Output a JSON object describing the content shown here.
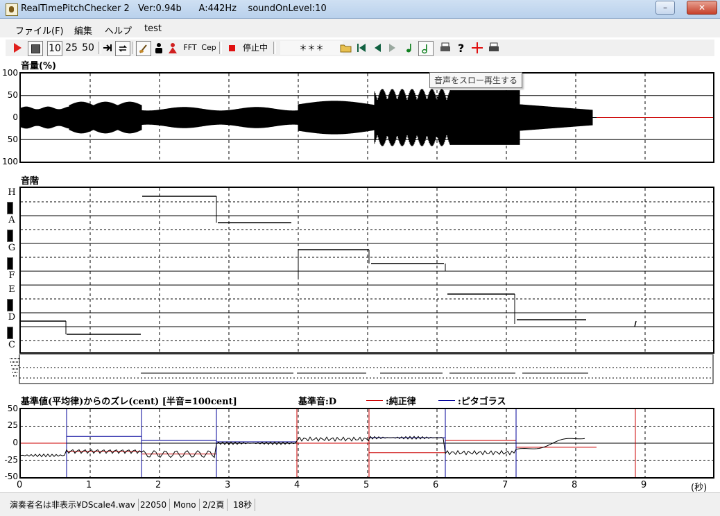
{
  "window": {
    "title": "RealTimePitchChecker 2",
    "version": "Ver:0.94b",
    "a_pitch": "A:442Hz",
    "sound_on_level": "soundOnLevel:10",
    "minimize": "–",
    "maximize": "□",
    "close": "✕"
  },
  "menu": {
    "file": "ファイル(F)",
    "edit": "編集",
    "help": "ヘルプ",
    "test": "test"
  },
  "toolbar": {
    "speed_10": "10",
    "speed_25": "25",
    "speed_50": "50",
    "fft": "FFT",
    "cep": "Cep",
    "status": "停止中",
    "marker": "＊＊＊"
  },
  "tooltip": "音声をスロー再生する",
  "volume": {
    "title": "音量(%)",
    "ticks": [
      "100",
      "50",
      "0",
      "50",
      "100"
    ]
  },
  "scale": {
    "title": "音階",
    "notes": [
      "H",
      "A",
      "G",
      "F",
      "E",
      "D",
      "C"
    ]
  },
  "deviation": {
    "title": "基準値(平均律)からのズレ(cent) [半音=100cent]",
    "base_note": "基準音:D",
    "legend_pure": ":純正律",
    "legend_pyth": ":ピタゴラス",
    "ticks": [
      "50",
      "25",
      "0",
      "-25",
      "-50"
    ],
    "pure_color": "#cc0000",
    "pyth_color": "#000099"
  },
  "time_axis": {
    "ticks": [
      "0",
      "1",
      "2",
      "3",
      "4",
      "5",
      "6",
      "7",
      "8",
      "9"
    ],
    "unit": "(秒)"
  },
  "statusbar": {
    "file": "演奏者名は非表示¥DScale4.wav",
    "rate": "22050",
    "channels": "Mono",
    "page": "2/2頁",
    "duration": "18秒"
  }
}
